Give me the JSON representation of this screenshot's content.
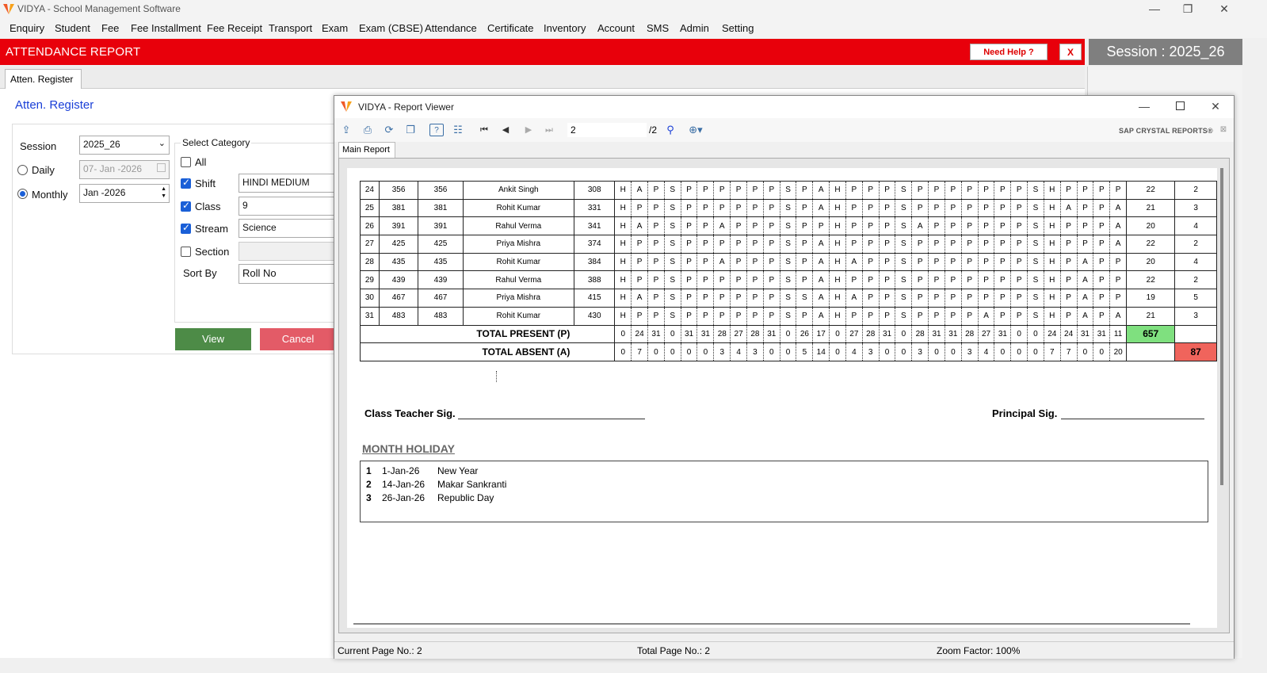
{
  "app": {
    "title": "VIDYA - School Management Software",
    "window_controls": [
      "—",
      "❐",
      "✕"
    ]
  },
  "menu": [
    "Enquiry",
    "Student",
    "Fee",
    "Fee Installment",
    "Fee Receipt",
    "Transport",
    "Exam",
    "Exam (CBSE)",
    "Attendance",
    "Certificate",
    "Inventory",
    "Account",
    "SMS",
    "Admin",
    "Setting"
  ],
  "header": {
    "title": "ATTENDANCE REPORT",
    "help": "Need Help ?",
    "close": "X",
    "session": "Session : 2025_26"
  },
  "left": {
    "tab": "Atten. Register",
    "title": "Atten. Register",
    "session_label": "Session",
    "session_value": "2025_26",
    "daily_label": "Daily",
    "daily_value": "07- Jan -2026",
    "monthly_label": "Monthly",
    "monthly_value": "Jan -2026",
    "category_title": "Select Category",
    "all_label": "All",
    "shift_label": "Shift",
    "shift_value": "HINDI MEDIUM",
    "class_label": "Class",
    "class_value": "9",
    "stream_label": "Stream",
    "stream_value": "Science",
    "section_label": "Section",
    "section_value": "",
    "sortby_label": "Sort By",
    "sortby_value": "Roll No",
    "view": "View",
    "cancel": "Cancel"
  },
  "viewer": {
    "title": "VIDYA - Report Viewer",
    "page_input": "2",
    "page_total": "/2",
    "brand": "SAP CRYSTAL REPORTS®",
    "tab": "Main Report",
    "status_current": "Current Page No.: 2",
    "status_total": "Total Page No.: 2",
    "status_zoom": "Zoom Factor: 100%"
  },
  "report": {
    "rows": [
      {
        "sn": "24",
        "adm": "356",
        "roll": "356",
        "name": "Ankit Singh",
        "id": "308",
        "days": [
          "H",
          "A",
          "P",
          "S",
          "P",
          "P",
          "P",
          "P",
          "P",
          "P",
          "S",
          "P",
          "A",
          "H",
          "P",
          "P",
          "P",
          "S",
          "P",
          "P",
          "P",
          "P",
          "P",
          "P",
          "P",
          "S",
          "H",
          "P",
          "P",
          "P",
          "P"
        ],
        "present": "22",
        "absent": "2"
      },
      {
        "sn": "25",
        "adm": "381",
        "roll": "381",
        "name": "Rohit Kumar",
        "id": "331",
        "days": [
          "H",
          "P",
          "P",
          "S",
          "P",
          "P",
          "P",
          "P",
          "P",
          "P",
          "S",
          "P",
          "A",
          "H",
          "P",
          "P",
          "P",
          "S",
          "P",
          "P",
          "P",
          "P",
          "P",
          "P",
          "P",
          "S",
          "H",
          "A",
          "P",
          "P",
          "A"
        ],
        "present": "21",
        "absent": "3"
      },
      {
        "sn": "26",
        "adm": "391",
        "roll": "391",
        "name": "Rahul Verma",
        "id": "341",
        "days": [
          "H",
          "A",
          "P",
          "S",
          "P",
          "P",
          "A",
          "P",
          "P",
          "P",
          "S",
          "P",
          "P",
          "H",
          "P",
          "P",
          "P",
          "S",
          "A",
          "P",
          "P",
          "P",
          "P",
          "P",
          "P",
          "S",
          "H",
          "P",
          "P",
          "P",
          "A"
        ],
        "present": "20",
        "absent": "4"
      },
      {
        "sn": "27",
        "adm": "425",
        "roll": "425",
        "name": "Priya Mishra",
        "id": "374",
        "days": [
          "H",
          "P",
          "P",
          "S",
          "P",
          "P",
          "P",
          "P",
          "P",
          "P",
          "S",
          "P",
          "A",
          "H",
          "P",
          "P",
          "P",
          "S",
          "P",
          "P",
          "P",
          "P",
          "P",
          "P",
          "P",
          "S",
          "H",
          "P",
          "P",
          "P",
          "A"
        ],
        "present": "22",
        "absent": "2"
      },
      {
        "sn": "28",
        "adm": "435",
        "roll": "435",
        "name": "Rohit Kumar",
        "id": "384",
        "days": [
          "H",
          "P",
          "P",
          "S",
          "P",
          "P",
          "A",
          "P",
          "P",
          "P",
          "S",
          "P",
          "A",
          "H",
          "A",
          "P",
          "P",
          "S",
          "P",
          "P",
          "P",
          "P",
          "P",
          "P",
          "P",
          "S",
          "H",
          "P",
          "A",
          "P",
          "P"
        ],
        "present": "20",
        "absent": "4"
      },
      {
        "sn": "29",
        "adm": "439",
        "roll": "439",
        "name": "Rahul Verma",
        "id": "388",
        "days": [
          "H",
          "P",
          "P",
          "S",
          "P",
          "P",
          "P",
          "P",
          "P",
          "P",
          "S",
          "P",
          "A",
          "H",
          "P",
          "P",
          "P",
          "S",
          "P",
          "P",
          "P",
          "P",
          "P",
          "P",
          "P",
          "S",
          "H",
          "P",
          "A",
          "P",
          "P"
        ],
        "present": "22",
        "absent": "2"
      },
      {
        "sn": "30",
        "adm": "467",
        "roll": "467",
        "name": "Priya Mishra",
        "id": "415",
        "days": [
          "H",
          "A",
          "P",
          "S",
          "P",
          "P",
          "P",
          "P",
          "P",
          "P",
          "S",
          "S",
          "A",
          "H",
          "A",
          "P",
          "P",
          "S",
          "P",
          "P",
          "P",
          "P",
          "P",
          "P",
          "P",
          "S",
          "H",
          "P",
          "A",
          "P",
          "P"
        ],
        "present": "19",
        "absent": "5"
      },
      {
        "sn": "31",
        "adm": "483",
        "roll": "483",
        "name": "Rohit Kumar",
        "id": "430",
        "days": [
          "H",
          "P",
          "P",
          "S",
          "P",
          "P",
          "P",
          "P",
          "P",
          "P",
          "S",
          "P",
          "A",
          "H",
          "P",
          "P",
          "P",
          "S",
          "P",
          "P",
          "P",
          "P",
          "A",
          "P",
          "P",
          "S",
          "H",
          "P",
          "A",
          "P",
          "A"
        ],
        "present": "21",
        "absent": "3"
      }
    ],
    "total_present_label": "TOTAL PRESENT (P)",
    "total_present": [
      "0",
      "24",
      "31",
      "0",
      "31",
      "31",
      "28",
      "27",
      "28",
      "31",
      "0",
      "26",
      "17",
      "0",
      "27",
      "28",
      "31",
      "0",
      "28",
      "31",
      "31",
      "28",
      "27",
      "31",
      "0",
      "0",
      "24",
      "24",
      "31",
      "31",
      "11"
    ],
    "total_present_sum": "657",
    "total_absent_label": "TOTAL ABSENT (A)",
    "total_absent": [
      "0",
      "7",
      "0",
      "0",
      "0",
      "0",
      "3",
      "4",
      "3",
      "0",
      "0",
      "5",
      "14",
      "0",
      "4",
      "3",
      "0",
      "0",
      "3",
      "0",
      "0",
      "3",
      "4",
      "0",
      "0",
      "0",
      "7",
      "7",
      "0",
      "0",
      "20"
    ],
    "total_absent_sum": "87",
    "teacher_sig": "Class Teacher Sig.",
    "principal_sig": "Principal Sig.",
    "holiday_title": "MONTH HOLIDAY",
    "holidays": [
      {
        "n": "1",
        "date": "1-Jan-26",
        "name": "New Year"
      },
      {
        "n": "2",
        "date": "14-Jan-26",
        "name": "Makar Sankranti"
      },
      {
        "n": "3",
        "date": "26-Jan-26",
        "name": "Republic Day"
      }
    ]
  },
  "colors": {
    "red_header": "#e8000b",
    "session_bg": "#7f7f7f",
    "view_btn": "#4d8b47",
    "cancel_btn": "#e35b67",
    "present_total": "#7fe07f",
    "absent_total": "#f0645c",
    "title_blue": "#1a3fd7"
  }
}
